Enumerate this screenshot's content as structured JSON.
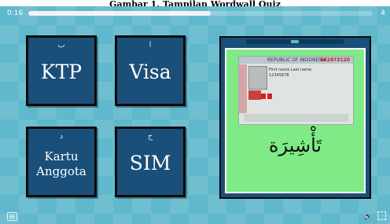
{
  "caption": "Gambar 1. Tampilan Wordwall Quiz",
  "player": {
    "time": "0:16",
    "counter": "4",
    "progress": 0.53
  },
  "tiles": [
    {
      "arabic_letter": "ب",
      "label": "KTP"
    },
    {
      "arabic_letter": "ا",
      "label": "Visa"
    },
    {
      "arabic_letter": "د",
      "label_line1": "Kartu",
      "label_line2": "Anggota"
    },
    {
      "arabic_letter": "ج",
      "label": "SIM"
    }
  ],
  "question": {
    "arabic_word": "تَأْشِيرَة",
    "card": {
      "country": "REPUBLIC OF INDONESIA",
      "number": "SF2873120",
      "name": "First name Last name",
      "id": "12345678"
    }
  },
  "icons": {
    "menu": "menu-icon",
    "volume": "volume-icon",
    "fullscreen": "fullscreen-icon"
  }
}
